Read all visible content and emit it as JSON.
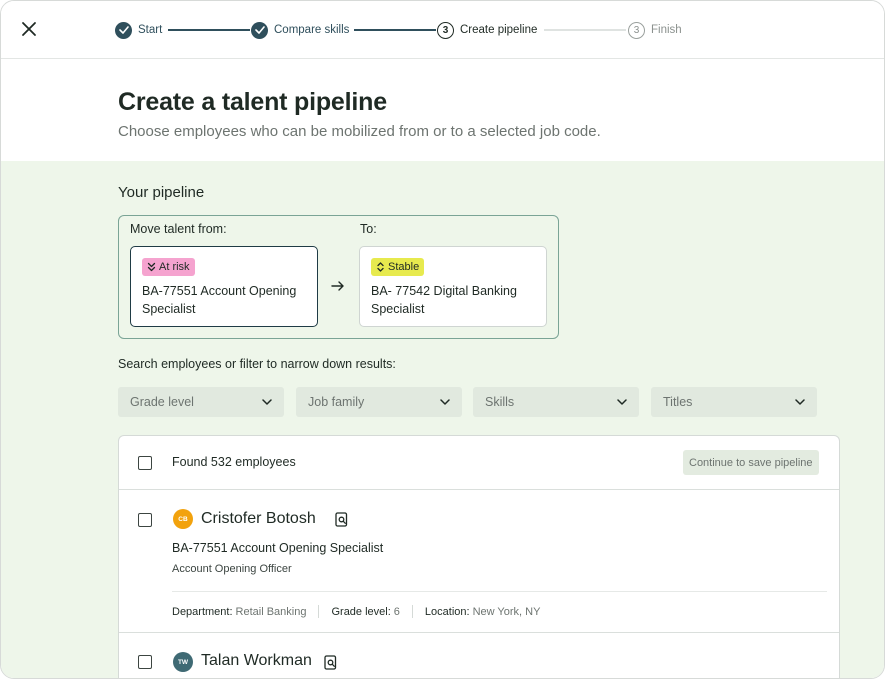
{
  "stepper": {
    "steps": [
      {
        "label": "Start",
        "state": "done"
      },
      {
        "label": "Compare skills",
        "state": "done"
      },
      {
        "label": "Create pipeline",
        "state": "current",
        "number": "3"
      },
      {
        "label": "Finish",
        "state": "todo",
        "number": "3"
      }
    ]
  },
  "header": {
    "title": "Create a talent pipeline",
    "subtitle": "Choose employees who can be mobilized from or to a selected job code."
  },
  "pipeline": {
    "section_title": "Your pipeline",
    "from_label": "Move talent from:",
    "to_label": "To:",
    "from": {
      "badge": "At risk",
      "job": "BA-77551 Account Opening Specialist",
      "badge_color": "#f5a3cf"
    },
    "to": {
      "badge": "Stable",
      "job": "BA- 77542 Digital Banking Specialist",
      "badge_color": "#e7ea4e"
    }
  },
  "filters": {
    "label": "Search employees or filter to narrow down results:",
    "items": [
      "Grade level",
      "Job family",
      "Skills",
      "Titles"
    ]
  },
  "results": {
    "found_text": "Found 532 employees",
    "save_button": "Continue to save pipeline",
    "employees": [
      {
        "initials": "CB",
        "avatar_color": "#f2a20d",
        "name": "Cristofer Botosh",
        "job": "BA-77551 Account Opening Specialist",
        "title": "Account Opening Officer",
        "department_label": "Department:",
        "department": "Retail Banking",
        "grade_label": "Grade level:",
        "grade": "6",
        "location_label": "Location:",
        "location": "New York, NY"
      },
      {
        "initials": "TW",
        "avatar_color": "#3f6a74",
        "name": "Talan Workman"
      }
    ]
  },
  "colors": {
    "accent": "#2f4f5c",
    "green_bg": "#eef6ea"
  }
}
